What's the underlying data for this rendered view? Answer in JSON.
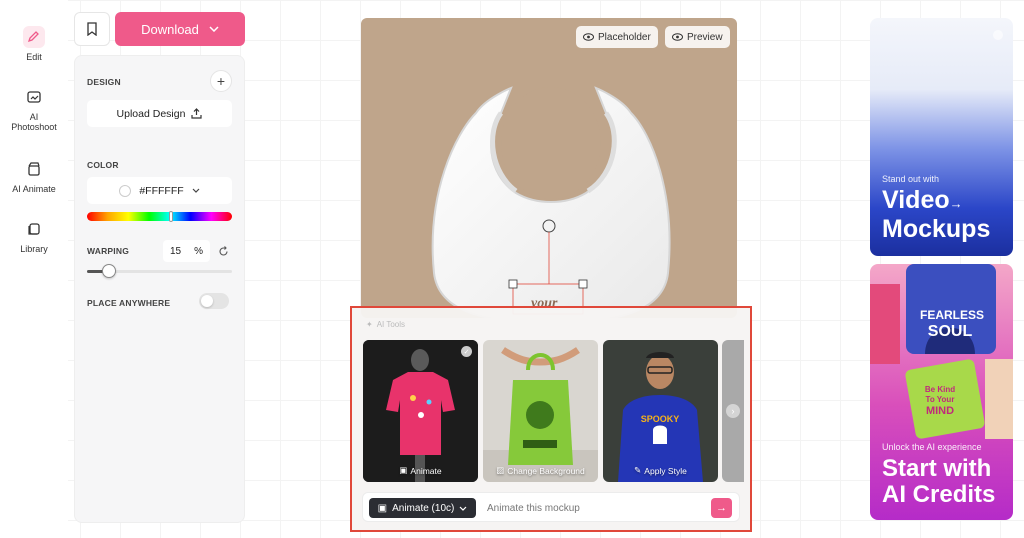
{
  "rail": {
    "items": [
      {
        "label": "Edit",
        "icon": "edit-icon"
      },
      {
        "label": "AI Photoshoot",
        "line1": "AI",
        "line2": "Photoshoot",
        "icon": "photoshoot-icon"
      },
      {
        "label": "AI Animate",
        "icon": "clapper-icon"
      },
      {
        "label": "Library",
        "icon": "library-icon"
      }
    ]
  },
  "toolbar": {
    "download_label": "Download"
  },
  "panel": {
    "design_label": "DESIGN",
    "upload_label": "Upload Design",
    "color_label": "COLOR",
    "color_value": "#FFFFFF",
    "warping_label": "WARPING",
    "warping_value": "15",
    "warping_unit": "%",
    "warping_level": 15,
    "place_anywhere_label": "PLACE ANYWHERE",
    "place_anywhere_on": false
  },
  "canvas": {
    "placeholder_label": "Placeholder",
    "preview_label": "Preview",
    "design_text": "your",
    "background_color": "#bfa58b"
  },
  "ai_tools": {
    "title": "AI Tools",
    "cards": [
      {
        "label": "Animate",
        "icon": "animate-icon"
      },
      {
        "label": "Change Background",
        "icon": "image-icon"
      },
      {
        "label": "Apply Style",
        "icon": "wand-icon"
      }
    ],
    "mode_label": "Animate (10c)",
    "prompt_placeholder": "Animate this mockup"
  },
  "promos": {
    "promo1": {
      "small": "Stand out with",
      "big_line1": "Video",
      "big_line2": "Mockups"
    },
    "promo2": {
      "small": "Unlock the AI experience",
      "big_line1": "Start with",
      "big_line2": "AI Credits"
    }
  },
  "colors": {
    "accent": "#ef5a8a",
    "highlight_border": "#e0483a"
  }
}
